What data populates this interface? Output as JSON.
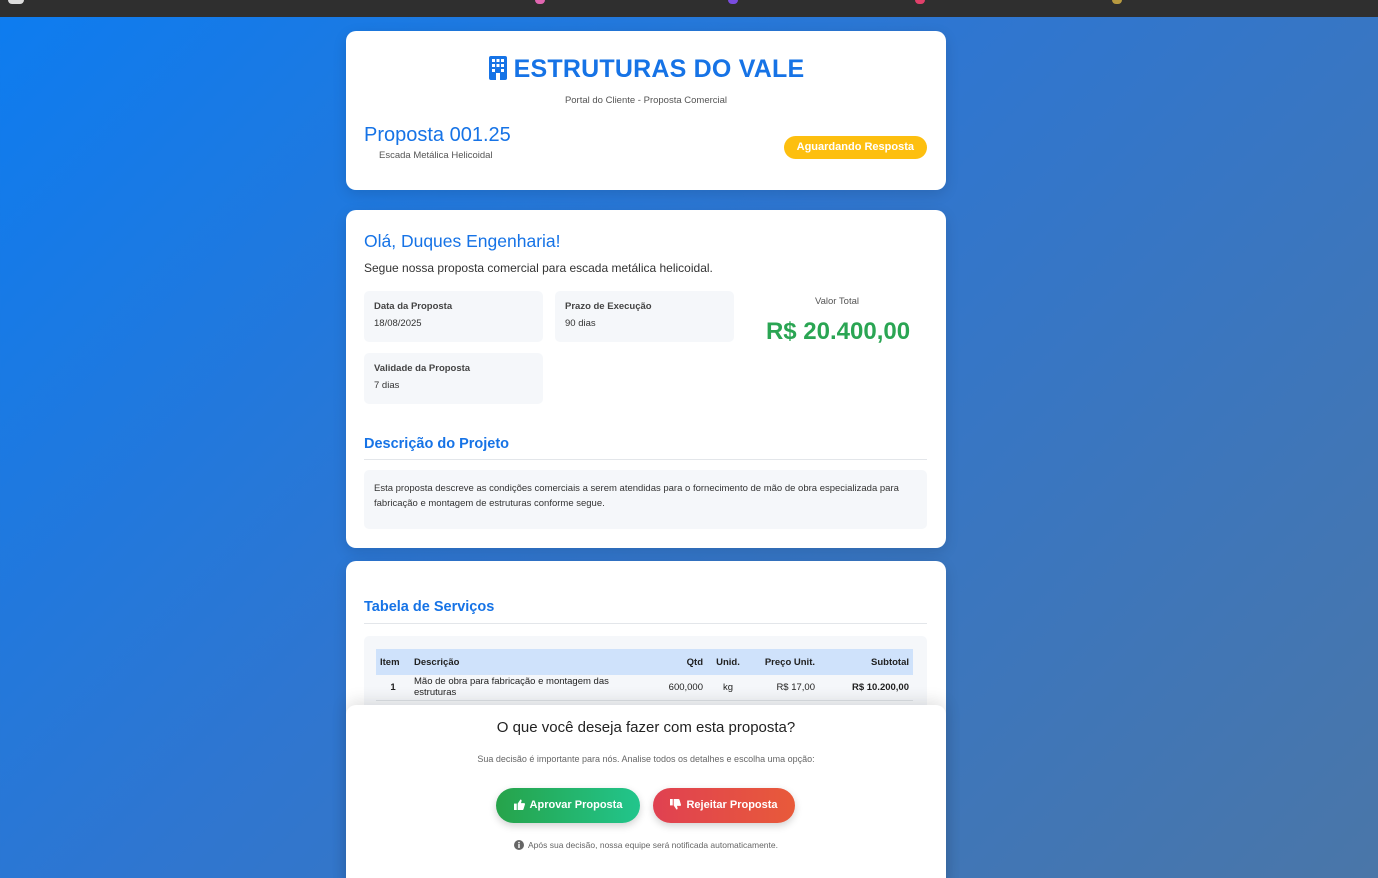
{
  "brand": {
    "name": "ESTRUTURAS DO VALE",
    "subtitle": "Portal do Cliente - Proposta Comercial"
  },
  "proposal": {
    "title": "Proposta 001.25",
    "subtitle": "Escada Metálica Helicoidal",
    "status": "Aguardando Resposta"
  },
  "info": {
    "greeting": "Olá, Duques Engenharia!",
    "intro": "Segue nossa proposta comercial para escada metálica helicoidal.",
    "fields": [
      {
        "label": "Data da Proposta",
        "value": "18/08/2025"
      },
      {
        "label": "Prazo de Execução",
        "value": "90 dias"
      },
      {
        "label": "Validade da Proposta",
        "value": "7 dias"
      }
    ],
    "total_label": "Valor Total",
    "total_value": "R$ 20.400,00"
  },
  "description": {
    "title": "Descrição do Projeto",
    "text": "Esta proposta descreve as condições comerciais a serem atendidas para o fornecimento de mão de obra especializada para fabricação e montagem de estruturas conforme segue."
  },
  "services": {
    "title": "Tabela de Serviços",
    "headers": [
      "Item",
      "Descrição",
      "Qtd",
      "Unid.",
      "Preço Unit.",
      "Subtotal"
    ],
    "rows": [
      [
        "1",
        "Mão de obra para fabricação e montagem das estruturas",
        "600,000",
        "kg",
        "R$ 17,00",
        "R$ 10.200,00"
      ]
    ]
  },
  "decision": {
    "question": "O que você deseja fazer com esta proposta?",
    "subtitle": "Sua decisão é importante para nós. Analise todos os detalhes e escolha uma opção:",
    "approve_label": "Aprovar Proposta",
    "reject_label": "Rejeitar Proposta",
    "note": "Após sua decisão, nossa equipe será notificada automaticamente."
  },
  "colors": {
    "primary": "#1673e6",
    "status": "#fdbf0f",
    "total": "#2aa553",
    "approve": "#26a34a",
    "reject": "#e04151"
  },
  "icons": [
    "building-icon",
    "thumbs-up-icon",
    "thumbs-down-icon",
    "info-icon"
  ]
}
